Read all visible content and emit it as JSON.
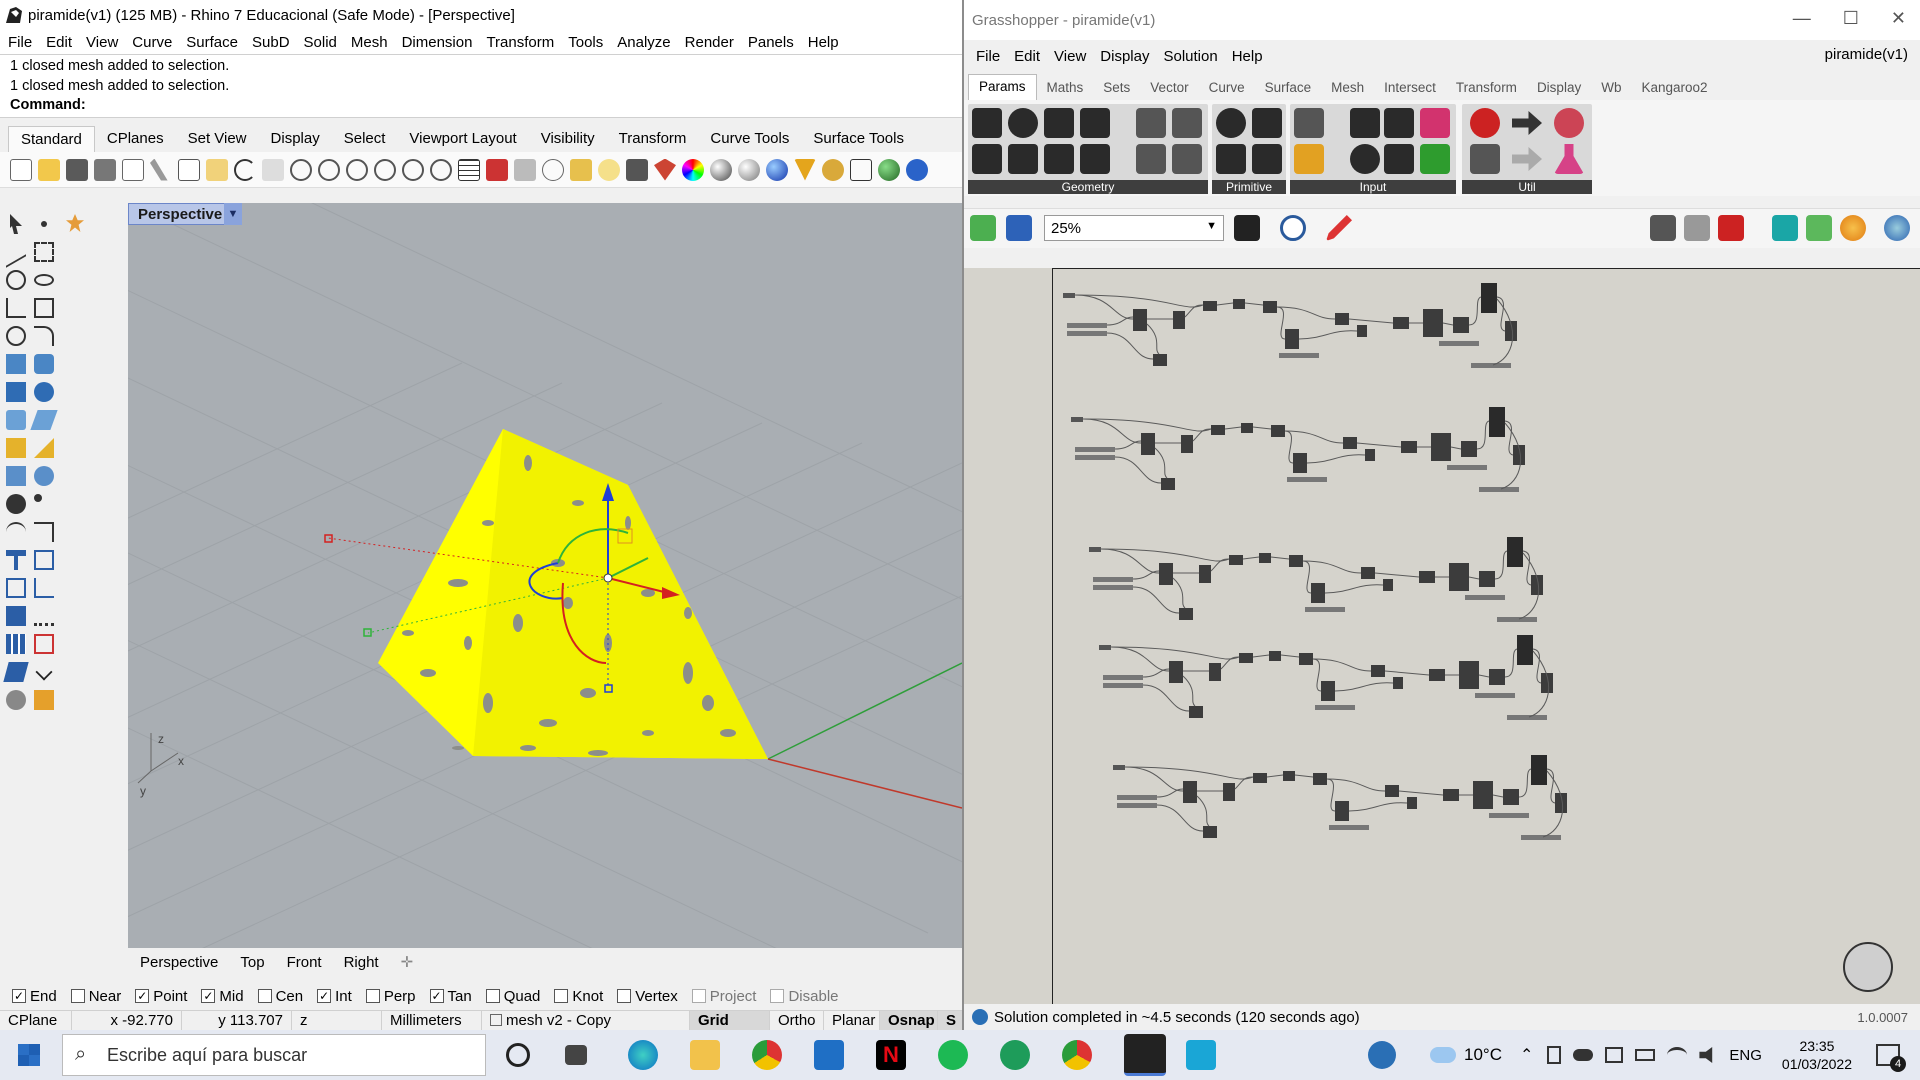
{
  "rhino": {
    "title": "piramide(v1) (125 MB) - Rhino 7 Educacional (Safe Mode) - [Perspective]",
    "menu": [
      "File",
      "Edit",
      "View",
      "Curve",
      "Surface",
      "SubD",
      "Solid",
      "Mesh",
      "Dimension",
      "Transform",
      "Tools",
      "Analyze",
      "Render",
      "Panels",
      "Help"
    ],
    "history": [
      "1 closed mesh added to selection.",
      "1 closed mesh added to selection."
    ],
    "command_label": "Command:",
    "toolbar_tabs": [
      "Standard",
      "CPlanes",
      "Set View",
      "Display",
      "Select",
      "Viewport Layout",
      "Visibility",
      "Transform",
      "Curve Tools",
      "Surface Tools"
    ],
    "viewport_name": "Perspective",
    "viewport_tabs": [
      "Perspective",
      "Top",
      "Front",
      "Right"
    ],
    "osnaps": [
      {
        "label": "End",
        "checked": true
      },
      {
        "label": "Near",
        "checked": false
      },
      {
        "label": "Point",
        "checked": true
      },
      {
        "label": "Mid",
        "checked": true
      },
      {
        "label": "Cen",
        "checked": false
      },
      {
        "label": "Int",
        "checked": true
      },
      {
        "label": "Perp",
        "checked": false
      },
      {
        "label": "Tan",
        "checked": true
      },
      {
        "label": "Quad",
        "checked": false
      },
      {
        "label": "Knot",
        "checked": false
      },
      {
        "label": "Vertex",
        "checked": false
      },
      {
        "label": "Project",
        "checked": false
      },
      {
        "label": "Disable",
        "checked": false
      }
    ],
    "status": {
      "cplane": "CPlane",
      "x": "x -92.770",
      "y": "y 113.707",
      "z": "z",
      "units": "Millimeters",
      "layer": "mesh v2 - Copy",
      "grid_snap": "Grid Snap",
      "ortho": "Ortho",
      "planar": "Planar",
      "osnap": "Osnap",
      "smarttrack": "S"
    },
    "axis_labels": {
      "z": "z",
      "y": "y",
      "x": "x"
    }
  },
  "grasshopper": {
    "title": "Grasshopper - piramide(v1)",
    "menu": [
      "File",
      "Edit",
      "View",
      "Display",
      "Solution",
      "Help"
    ],
    "document": "piramide(v1)",
    "tabs": [
      "Params",
      "Maths",
      "Sets",
      "Vector",
      "Curve",
      "Surface",
      "Mesh",
      "Intersect",
      "Transform",
      "Display",
      "Wb",
      "Kangaroo2"
    ],
    "groups": [
      "Geometry",
      "Primitive",
      "Input",
      "Util"
    ],
    "zoom": "25%",
    "status": "Solution completed in ~4.5 seconds (120 seconds ago)",
    "version": "1.0.0007"
  },
  "taskbar": {
    "search_placeholder": "Escribe aquí para buscar",
    "temperature": "10°C",
    "language": "ENG",
    "time": "23:35",
    "date": "01/03/2022",
    "notifications": "4"
  },
  "colors": {
    "mesh": "#ffff00",
    "viewport": "#a9aeb3",
    "canvas": "#d5d3cc",
    "grid": "#9aa0a6"
  }
}
